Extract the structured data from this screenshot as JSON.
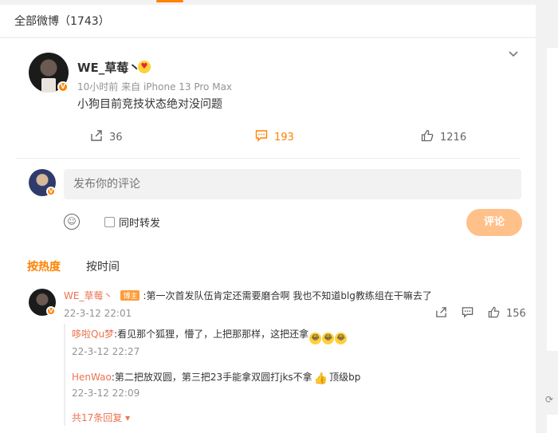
{
  "header": {
    "title": "全部微博（1743）"
  },
  "post": {
    "username": "WE_草莓丶",
    "time": "10小时前",
    "source_prefix": "来自",
    "source": "iPhone 13 Pro Max",
    "text": "小狗目前竞技状态绝对没问题",
    "actions": {
      "repost_count": "36",
      "comment_count": "193",
      "like_count": "1216"
    }
  },
  "comment_box": {
    "placeholder": "发布你的评论",
    "repost_label": "同时转发",
    "submit_label": "评论"
  },
  "sort_tabs": {
    "hot": "按热度",
    "time": "按时间"
  },
  "comments": [
    {
      "username": "WE_草莓丶",
      "tag": "博主",
      "text": ":第一次首发队伍肯定还需要磨合啊  我也不知道blg教练组在干嘛去了",
      "time": "22-3-12 22:01",
      "like_count": "156",
      "replies": [
        {
          "username": "哆啦Qu梦",
          "text": ":看见那个狐狸，懵了，上把那那样，这把还拿",
          "time": "22-3-12 22:27"
        },
        {
          "username": "HenWao",
          "text": ":第二把放双圆，第三把23手能拿双圆打jks不拿",
          "text_after": "顶级bp",
          "time": "22-3-12 22:09"
        }
      ],
      "more_replies": "共17条回复"
    }
  ],
  "colors": {
    "accent": "#ff8200",
    "name_link": "#eb7350",
    "meta_gray": "#939393"
  }
}
